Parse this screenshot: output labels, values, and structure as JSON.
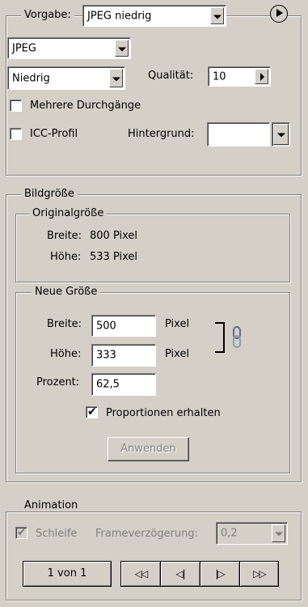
{
  "preset": {
    "label": "Vorgabe:",
    "value": "JPEG niedrig"
  },
  "format": {
    "value": "JPEG"
  },
  "quality_preset": {
    "value": "Niedrig"
  },
  "quality": {
    "label": "Qualität:",
    "value": "10"
  },
  "progressive": {
    "label": "Mehrere Durchgänge",
    "checked": false
  },
  "icc_profile": {
    "label": "ICC-Profil",
    "checked": false
  },
  "background": {
    "label": "Hintergrund:",
    "value": ""
  },
  "image_size": {
    "title": "Bildgröße",
    "original": {
      "title": "Originalgröße",
      "width_label": "Breite:",
      "width_value": "800 Pixel",
      "height_label": "Höhe:",
      "height_value": "533 Pixel"
    },
    "new": {
      "title": "Neue Größe",
      "width_label": "Breite:",
      "width_value": "500",
      "width_unit": "Pixel",
      "height_label": "Höhe:",
      "height_value": "333",
      "height_unit": "Pixel",
      "percent_label": "Prozent:",
      "percent_value": "62,5",
      "constrain_label": "Proportionen erhalten",
      "constrain_checked": true,
      "apply_label": "Anwenden"
    }
  },
  "animation": {
    "title": "Animation",
    "loop_label": "Schleife",
    "loop_checked": true,
    "delay_label": "Frameverzögerung:",
    "delay_value": "0,2",
    "frame_counter": "1 von 1",
    "controls": [
      {
        "name": "first-frame-icon",
        "glyph": "◁◁"
      },
      {
        "name": "previous-frame-icon",
        "glyph": "◁|"
      },
      {
        "name": "next-frame-icon",
        "glyph": "|▷"
      },
      {
        "name": "last-frame-icon",
        "glyph": "▷▷"
      }
    ]
  }
}
